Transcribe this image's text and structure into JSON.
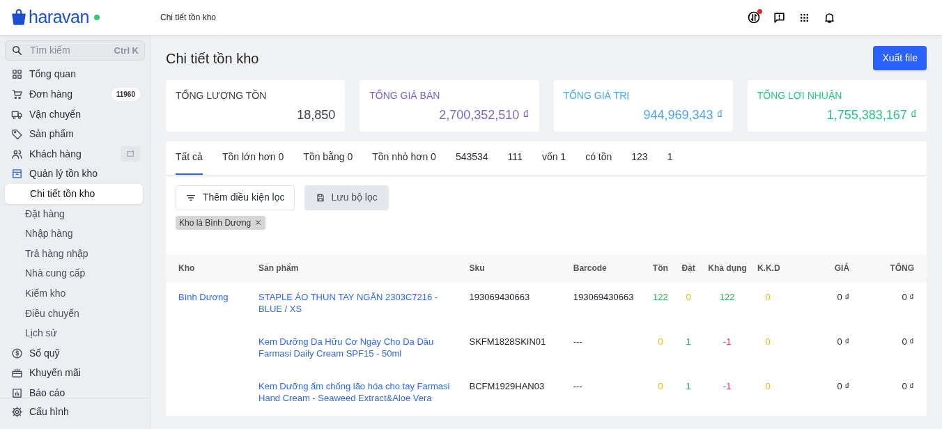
{
  "header": {
    "logo_text": "haravan",
    "online": true,
    "breadcrumb": "Chi tiết tồn kho",
    "has_update_notice": true
  },
  "sidebar": {
    "search": {
      "placeholder": "Tìm kiếm",
      "shortcut": "Ctrl K"
    },
    "items": [
      {
        "label": "Tổng quan",
        "selected": false,
        "expanded": false
      },
      {
        "label": "Đơn hàng",
        "selected": false,
        "expanded": false,
        "badge": "11960"
      },
      {
        "label": "Vận chuyển",
        "selected": false,
        "expanded": false
      },
      {
        "label": "Sản phẩm",
        "selected": false,
        "expanded": false
      },
      {
        "label": "Khách hàng",
        "selected": false,
        "expanded": false,
        "has_action": true
      },
      {
        "label": "Quản lý tồn kho",
        "selected": false,
        "expanded": true,
        "children": [
          {
            "label": "Chi tiết tồn kho",
            "selected": true
          },
          {
            "label": "Đặt hàng",
            "selected": false
          },
          {
            "label": "Nhập hàng",
            "selected": false
          },
          {
            "label": "Trả hàng nhập",
            "selected": false
          },
          {
            "label": "Nhà cung cấp",
            "selected": false
          },
          {
            "label": "Kiểm kho",
            "selected": false
          },
          {
            "label": "Điều chuyển",
            "selected": false
          },
          {
            "label": "Lịch sử",
            "selected": false
          }
        ]
      },
      {
        "label": "Sổ quỹ",
        "selected": false,
        "expanded": false
      },
      {
        "label": "Khuyến mãi",
        "selected": false,
        "expanded": false
      },
      {
        "label": "Báo cáo",
        "selected": false,
        "expanded": false
      }
    ],
    "footer_item": {
      "label": "Cấu hình"
    }
  },
  "page": {
    "title": "Chi tiết tồn kho",
    "export_button": "Xuất file"
  },
  "stats": [
    {
      "label": "TỔNG LƯỢNG TỒN",
      "value": "18,850",
      "color": "#3a3f4b"
    },
    {
      "label": "TỔNG GIÁ BÁN",
      "value": "2,700,352,510 ₫",
      "color": "#7c66c9"
    },
    {
      "label": "TỔNG GIÁ TRỊ",
      "value": "944,969,343 ₫",
      "color": "#4fa6ef"
    },
    {
      "label": "TỔNG LỢI NHUẬN",
      "value": "1,755,383,167 ₫",
      "color": "#2ec486"
    }
  ],
  "tabs": [
    {
      "label": "Tất cả",
      "selected": true
    },
    {
      "label": "Tồn lớn hơn 0",
      "selected": false
    },
    {
      "label": "Tồn bằng 0",
      "selected": false
    },
    {
      "label": "Tồn nhỏ hơn 0",
      "selected": false
    },
    {
      "label": "543534",
      "selected": false
    },
    {
      "label": "111",
      "selected": false
    },
    {
      "label": "vốn 1",
      "selected": false
    },
    {
      "label": "có tồn",
      "selected": false
    },
    {
      "label": "123",
      "selected": false
    },
    {
      "label": "1",
      "selected": false
    }
  ],
  "filter": {
    "add_button": "Thêm điều kiện lọc",
    "save_button": "Lưu bộ lọc",
    "chips": [
      "Kho là Bình Dương"
    ]
  },
  "table": {
    "columns": [
      "Kho",
      "Sản phẩm",
      "Sku",
      "Barcode",
      "Tồn",
      "Đặt",
      "Khả dụng",
      "K.K.D",
      "GIÁ",
      "TỔNG"
    ],
    "rows": [
      {
        "warehouse": "Bình Dương",
        "product": "STAPLE ÁO THUN TAY NGẮN 2303C7216 - BLUE / XS",
        "sku": "193069430663",
        "barcode": "193069430663",
        "counts": [
          {
            "text": "122",
            "color": "#2eae5a"
          },
          {
            "text": "0",
            "color": "#f5b400"
          },
          {
            "text": "122",
            "color": "#2eae5a"
          },
          {
            "text": "0",
            "color": "#f5b400"
          }
        ],
        "price": "0 ₫",
        "total": "0 ₫"
      },
      {
        "warehouse": "",
        "product": "Kem Dưỡng Da Hữu Cơ Ngày Cho Da Dầu Farmasi Daily Cream SPF15 - 50ml",
        "sku": "SKFM1828SKIN01",
        "barcode": "---",
        "counts": [
          {
            "text": "0",
            "color": "#f5b400"
          },
          {
            "text": "1",
            "color": "#2eae5a"
          },
          {
            "text": "-1",
            "color": "#e0345a"
          },
          {
            "text": "0",
            "color": "#f5b400"
          }
        ],
        "price": "0 ₫",
        "total": "0 ₫"
      },
      {
        "warehouse": "",
        "product": "Kem Dưỡng ẩm chống lão hóa cho tay Farmasi Hand Cream - Seaweed Extract&Aloe Vera",
        "sku": "BCFM1929HAN03",
        "barcode": "---",
        "counts": [
          {
            "text": "0",
            "color": "#f5b400"
          },
          {
            "text": "1",
            "color": "#2eae5a"
          },
          {
            "text": "-1",
            "color": "#e0345a"
          },
          {
            "text": "0",
            "color": "#f5b400"
          }
        ],
        "price": "0 ₫",
        "total": "0 ₫"
      }
    ]
  }
}
